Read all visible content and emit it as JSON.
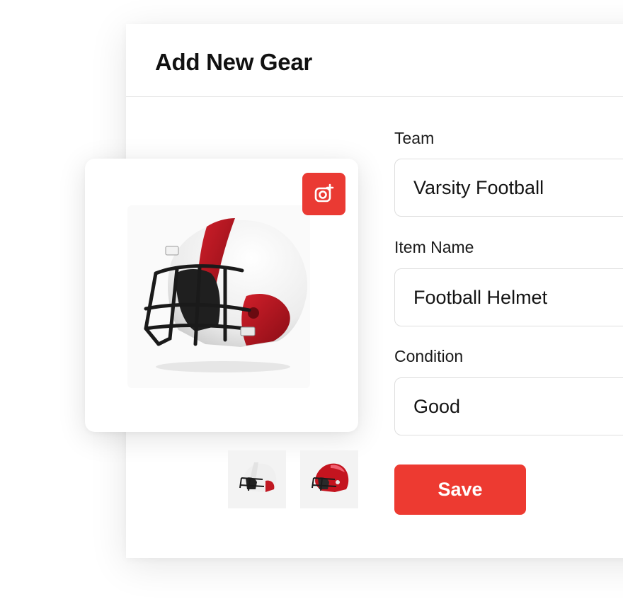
{
  "header": {
    "title": "Add New Gear"
  },
  "form": {
    "team": {
      "label": "Team",
      "value": "Varsity Football"
    },
    "item_name": {
      "label": "Item Name",
      "value": "Football Helmet"
    },
    "condition": {
      "label": "Condition",
      "value": "Good"
    },
    "save_label": "Save"
  },
  "image": {
    "main_icon": "football-helmet",
    "add_photo_icon": "camera-plus-icon",
    "thumbnails": [
      "white-red-helmet",
      "red-helmet"
    ]
  },
  "colors": {
    "accent": "#ED3A31",
    "helmet_white": "#F4F4F4",
    "helmet_red": "#B3141F",
    "facemask": "#1A1A1A"
  }
}
